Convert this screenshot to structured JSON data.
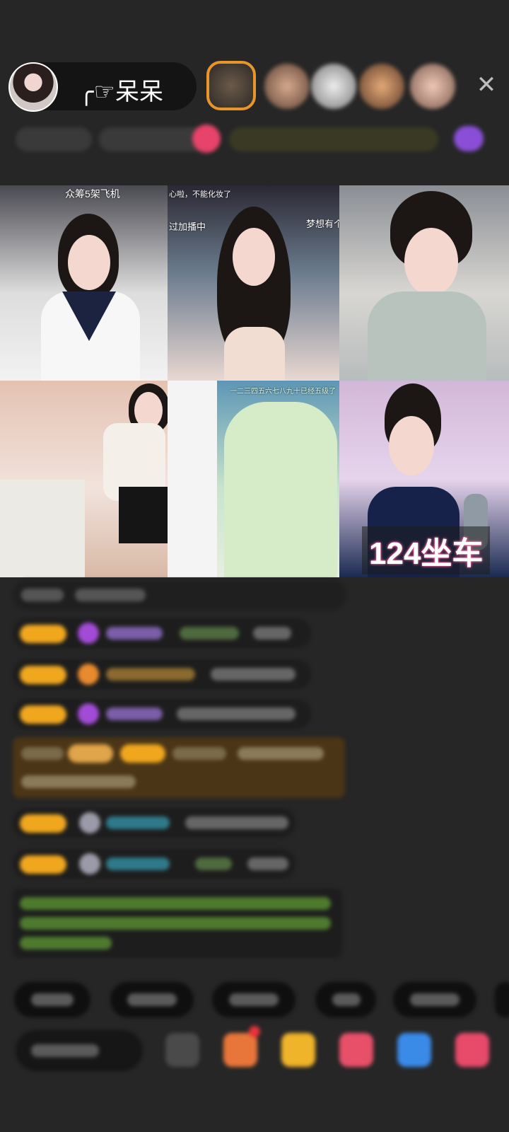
{
  "header": {
    "host_name": "╭☞呆呆",
    "close_icon": "close-icon"
  },
  "video_tiles": [
    {
      "caption": "众筹5架飞机"
    },
    {
      "caption_top": "心啦，不能化妆了",
      "caption_left": "过加播中",
      "caption_right": "梦想有个"
    },
    {},
    {},
    {
      "caption": "一二三四五六七八九十已经五级了"
    },
    {
      "seat_label": "124坐车"
    }
  ],
  "colors": {
    "background": "#262626",
    "badge": "#f0a71e",
    "chat_bubble": "#1d1d1d",
    "highlight_bubble": "#4a3516",
    "accent_pink": "#ff5fa0",
    "green_text": "#6fa83a"
  }
}
